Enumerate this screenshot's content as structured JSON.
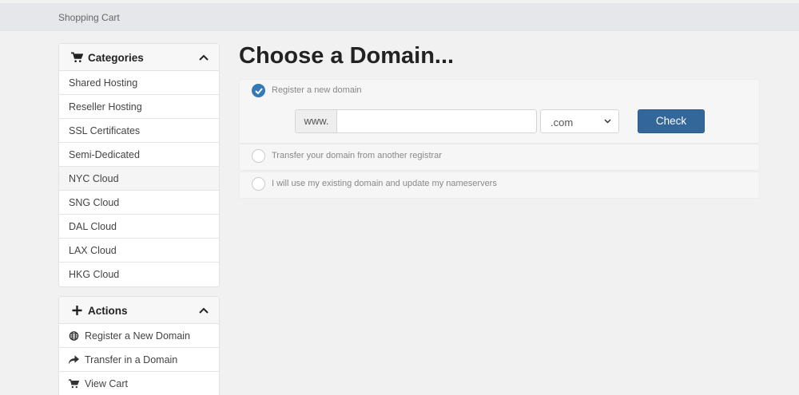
{
  "breadcrumb": "Shopping Cart",
  "categories": {
    "title": "Categories",
    "items": [
      "Shared Hosting",
      "Reseller Hosting",
      "SSL Certificates",
      "Semi-Dedicated",
      "NYC Cloud",
      "SNG Cloud",
      "DAL Cloud",
      "LAX Cloud",
      "HKG Cloud"
    ]
  },
  "actions": {
    "title": "Actions",
    "items": [
      {
        "label": "Register a New Domain",
        "icon": "globe-icon"
      },
      {
        "label": "Transfer in a Domain",
        "icon": "share-arrow-icon"
      },
      {
        "label": "View Cart",
        "icon": "cart-icon"
      }
    ]
  },
  "main": {
    "title": "Choose a Domain...",
    "options": {
      "register": "Register a new domain",
      "transfer": "Transfer your domain from another registrar",
      "existing": "I will use my existing domain and update my nameservers"
    },
    "prefix": "www.",
    "domain_value": "",
    "tld": ".com",
    "check_label": "Check",
    "selected_option": "register"
  },
  "colors": {
    "accent": "#336699",
    "radio_checked": "#337ab7"
  }
}
